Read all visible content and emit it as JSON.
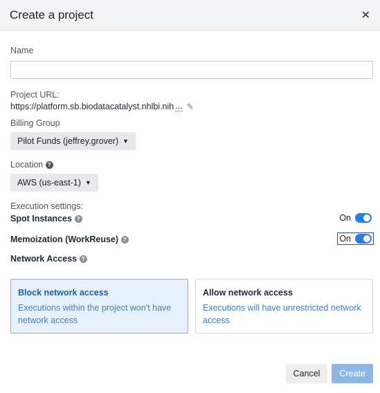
{
  "modal": {
    "title": "Create a project",
    "close_icon": "close-icon"
  },
  "name": {
    "label": "Name",
    "value": "",
    "placeholder": ""
  },
  "project_url": {
    "label": "Project URL:",
    "value": "https://platform.sb.biodatacatalyst.nhlbi.nih",
    "ellipsis": "..."
  },
  "billing": {
    "label": "Billing Group",
    "selected": "Pilot Funds (jeffrey.grover)"
  },
  "location": {
    "label": "Location",
    "selected": "AWS (us-east-1)"
  },
  "execution": {
    "label": "Execution settings:",
    "spot": {
      "label": "Spot Instances",
      "state": "On"
    },
    "memo": {
      "label": "Memoization (WorkReuse)",
      "state": "On"
    },
    "network_label": "Network Access"
  },
  "network_options": [
    {
      "title": "Block network access",
      "desc": "Executions within the project won't have network access",
      "selected": true
    },
    {
      "title": "Allow network access",
      "desc": "Executions will have unrestricted network access",
      "selected": false
    }
  ],
  "footer": {
    "cancel": "Cancel",
    "create": "Create"
  },
  "colors": {
    "accent": "#2a7de1",
    "create_button": "#8fb7e3",
    "selected_card_bg": "#e6f1fb"
  }
}
